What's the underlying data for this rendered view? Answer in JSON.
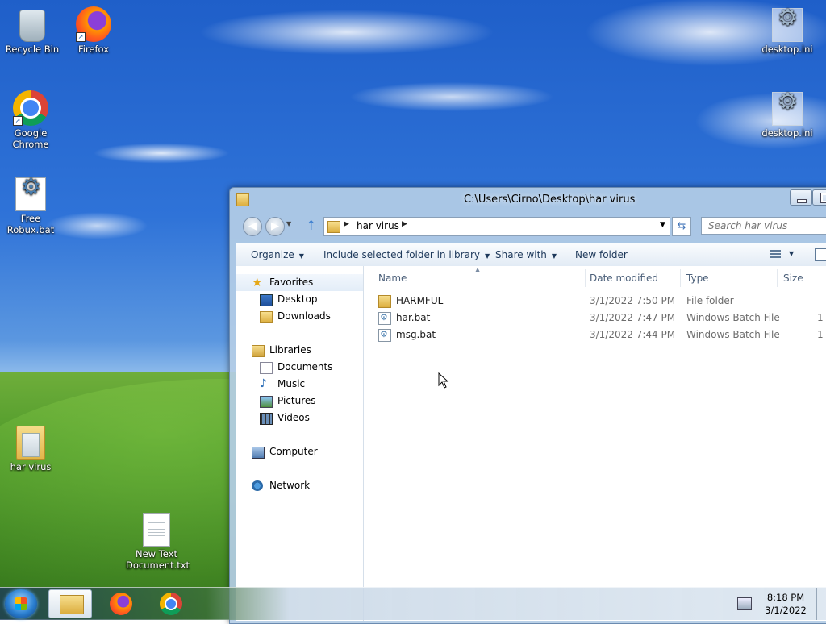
{
  "desktop": {
    "icons": [
      {
        "label": "Recycle Bin"
      },
      {
        "label": "Firefox"
      },
      {
        "label": "Google Chrome"
      },
      {
        "label": "Free Robux.bat"
      },
      {
        "label": "har virus"
      },
      {
        "label": "New Text Document.txt"
      },
      {
        "label": "desktop.ini"
      },
      {
        "label": "desktop.ini"
      }
    ]
  },
  "window": {
    "title": "C:\\Users\\Cirno\\Desktop\\har virus",
    "address": {
      "crumb": "har virus"
    },
    "search_placeholder": "Search har virus",
    "toolbar": {
      "organize": "Organize",
      "include": "Include selected folder in library",
      "share": "Share with",
      "new_folder": "New folder"
    },
    "nav": {
      "favorites": "Favorites",
      "desktop": "Desktop",
      "downloads": "Downloads",
      "libraries": "Libraries",
      "documents": "Documents",
      "music": "Music",
      "pictures": "Pictures",
      "videos": "Videos",
      "computer": "Computer",
      "network": "Network"
    },
    "columns": {
      "name": "Name",
      "date": "Date modified",
      "type": "Type",
      "size": "Size"
    },
    "files": [
      {
        "name": "HARMFUL",
        "date": "3/1/2022 7:50 PM",
        "type": "File folder",
        "size": ""
      },
      {
        "name": "har.bat",
        "date": "3/1/2022 7:47 PM",
        "type": "Windows Batch File",
        "size": "1"
      },
      {
        "name": "msg.bat",
        "date": "3/1/2022 7:44 PM",
        "type": "Windows Batch File",
        "size": "1"
      }
    ]
  },
  "taskbar": {
    "clock": {
      "time": "8:18 PM",
      "date": "3/1/2022"
    }
  }
}
